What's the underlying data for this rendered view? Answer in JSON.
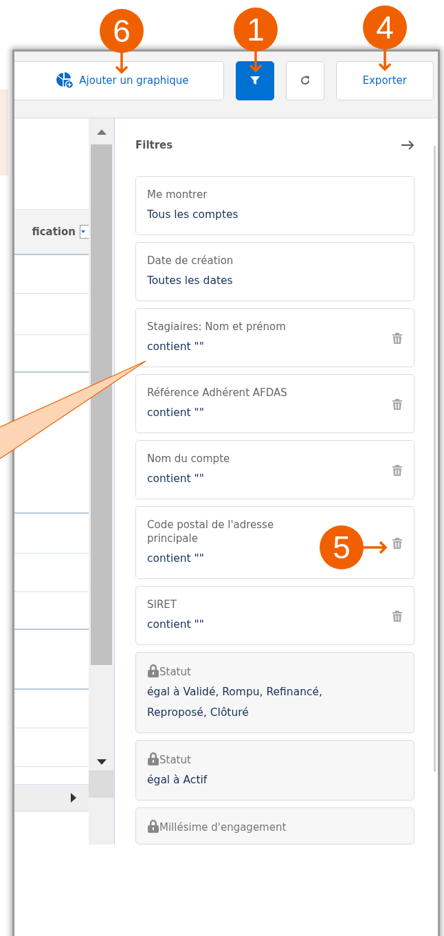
{
  "toolbar": {
    "buttons": [
      {
        "kind": "chart",
        "label": "Ajouter un graphique"
      },
      {
        "kind": "filter",
        "selected": true
      },
      {
        "kind": "refresh"
      },
      {
        "kind": "export",
        "label": "Exporter"
      }
    ]
  },
  "table": {
    "column_header": "fication"
  },
  "filters": {
    "title": "Filtres",
    "items": [
      {
        "label": "Me montrer",
        "value": "Tous les comptes",
        "removable": false,
        "locked": false
      },
      {
        "label": "Date de création",
        "value": "Toutes les dates",
        "removable": false,
        "locked": false
      },
      {
        "label": "Stagiaires: Nom et prénom",
        "value": "contient \"\"",
        "removable": true,
        "locked": false
      },
      {
        "label": "Référence Adhérent AFDAS",
        "value": "contient \"\"",
        "removable": true,
        "locked": false
      },
      {
        "label": "Nom du compte",
        "value": "contient \"\"",
        "removable": true,
        "locked": false
      },
      {
        "label": "Code postal de l'adresse principale",
        "value": "contient \"\"",
        "removable": true,
        "locked": false
      },
      {
        "label": "SIRET",
        "value": "contient \"\"",
        "removable": true,
        "locked": false
      },
      {
        "label": "Statut",
        "value": "égal à Validé, Rompu, Refinancé, Reproposé, Clôturé",
        "removable": false,
        "locked": true
      },
      {
        "label": "Statut",
        "value": "égal à Actif",
        "removable": false,
        "locked": true
      },
      {
        "label": "Millésime d'engagement",
        "removable": false,
        "locked": true
      }
    ]
  },
  "annotations": [
    {
      "number": "6"
    },
    {
      "number": "1"
    },
    {
      "number": "4"
    },
    {
      "number": "5"
    }
  ]
}
